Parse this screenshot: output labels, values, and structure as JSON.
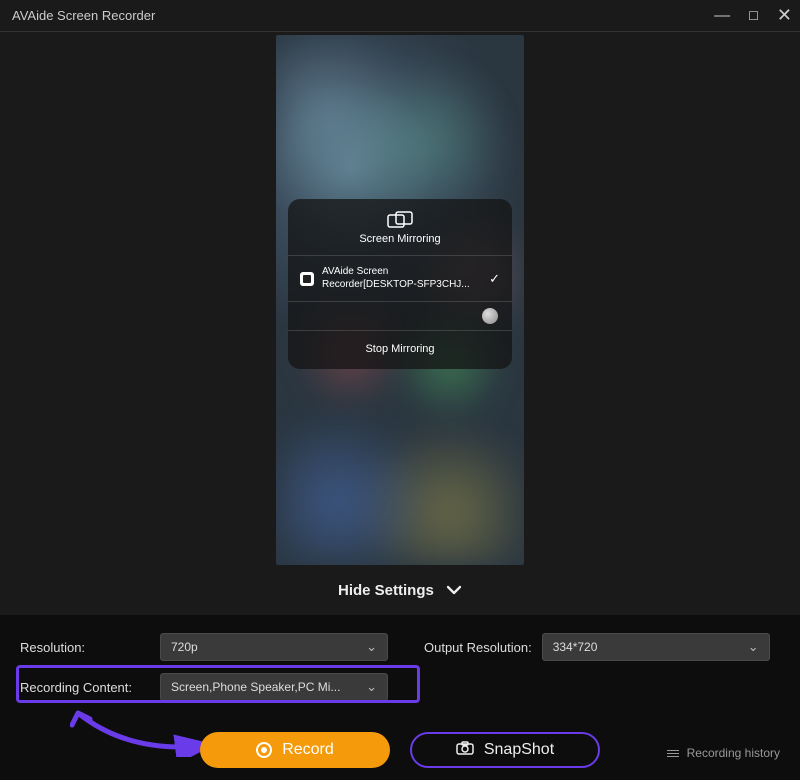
{
  "title": "AVAide Screen Recorder",
  "mirror": {
    "panel_title": "Screen Mirroring",
    "device_name": "AVAide Screen Recorder[DESKTOP-SFP3CHJ...",
    "stop_label": "Stop Mirroring"
  },
  "hide_settings_label": "Hide Settings",
  "settings": {
    "resolution_label": "Resolution:",
    "resolution_value": "720p",
    "output_label": "Output Resolution:",
    "output_value": "334*720",
    "content_label": "Recording Content:",
    "content_value": "Screen,Phone Speaker,PC Mi..."
  },
  "actions": {
    "record_label": "Record",
    "snapshot_label": "SnapShot",
    "history_label": "Recording history"
  }
}
